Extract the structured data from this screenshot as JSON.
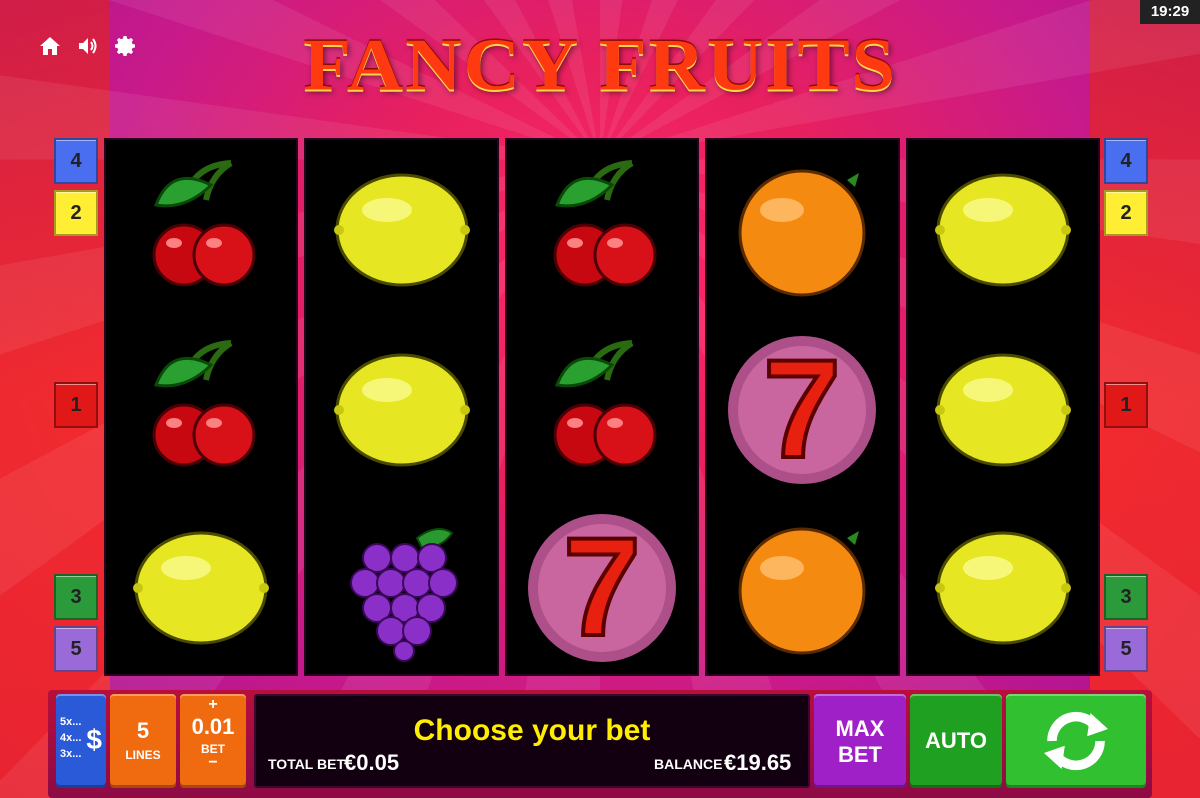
{
  "status": {
    "clock": "19:29"
  },
  "toolbar": {
    "home_icon": "home-icon",
    "sound_icon": "speaker-icon",
    "settings_icon": "gear-icon"
  },
  "game": {
    "title": "FANCY FRUITS"
  },
  "paylines": {
    "left": [
      "4",
      "2",
      "1",
      "3",
      "5"
    ],
    "right": [
      "4",
      "2",
      "1",
      "3",
      "5"
    ],
    "colors": {
      "4": "#4a6ef0",
      "2": "#ffee33",
      "1": "#e01818",
      "3": "#2a9a3a",
      "5": "#9a6ad8"
    }
  },
  "reels": [
    [
      "cherry",
      "cherry",
      "lemon"
    ],
    [
      "lemon",
      "lemon",
      "grapes"
    ],
    [
      "cherry",
      "cherry",
      "seven"
    ],
    [
      "orange",
      "seven",
      "orange"
    ],
    [
      "lemon",
      "lemon",
      "lemon"
    ]
  ],
  "controls": {
    "denominations": [
      "5x...",
      "4x...",
      "3x..."
    ],
    "currency_symbol": "$",
    "lines_value": "5",
    "lines_label": "LINES",
    "bet_plus": "+",
    "bet_value": "0.01",
    "bet_label": "BET",
    "bet_minus": "−",
    "message": "Choose your bet",
    "total_bet_label": "TOTAL BET",
    "total_bet_value": "€0.05",
    "balance_label": "BALANCE",
    "balance_value": "€19.65",
    "max_bet_line1": "MAX",
    "max_bet_line2": "BET",
    "auto_label": "AUTO",
    "spin_icon": "refresh-icon"
  },
  "colors": {
    "denom_button": "#2a5ad8",
    "lines_button": "#f06a10",
    "maxbet_button": "#a020c8",
    "auto_button": "#20a020",
    "spin_button": "#30c030",
    "message_text": "#ffee00"
  }
}
